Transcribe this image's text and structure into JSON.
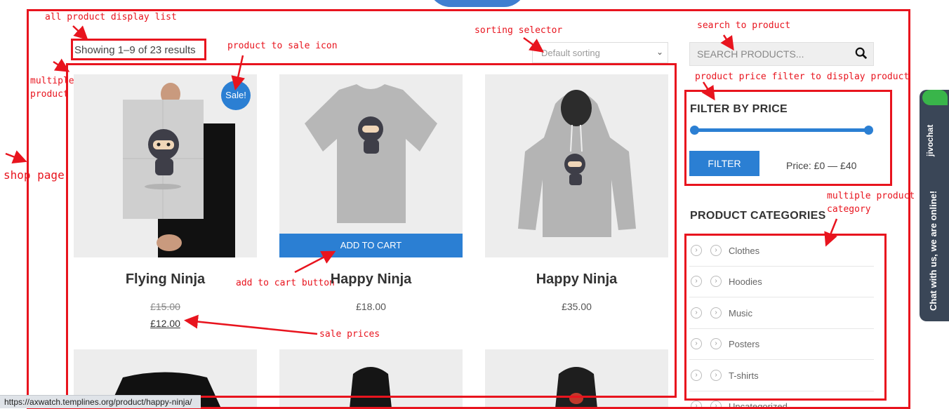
{
  "shop": {
    "results_count": "Showing 1–9 of 23 results",
    "sort_selected": "Default sorting",
    "search_placeholder": "SEARCH PRODUCTS..."
  },
  "products": [
    {
      "title": "Flying Ninja",
      "price_old": "£15.00",
      "price_new": "£12.00",
      "sale_label": "Sale!"
    },
    {
      "title": "Happy Ninja",
      "price": "£18.00",
      "cart_label": "ADD TO CART"
    },
    {
      "title": "Happy Ninja",
      "price": "£35.00"
    }
  ],
  "filter": {
    "title": "FILTER BY PRICE",
    "button_label": "FILTER",
    "price_text": "Price: £0 — £40"
  },
  "categories": {
    "title": "PRODUCT CATEGORIES",
    "items": [
      "Clothes",
      "Hoodies",
      "Music",
      "Posters",
      "T-shirts",
      "Uncategorized"
    ]
  },
  "annotations": {
    "all_product": "all product display list",
    "sale_icon": "product to sale icon",
    "sorting": "sorting selector",
    "search": "search to product",
    "price_filter": "product price filter to display product",
    "multiple_product_1": "multiple",
    "multiple_product_2": "product",
    "shop_page": "shop page",
    "multi_cat_1": "multiple product",
    "multi_cat_2": "category",
    "add_to_cart": "add to cart button",
    "sale_prices": "sale prices"
  },
  "chat": {
    "brand": "jivochat",
    "message": "Chat with us, we are online!"
  },
  "status_bar": {
    "url": "https://axwatch.templines.org/product/happy-ninja/"
  },
  "colors": {
    "annotation_red": "#e8141e",
    "accent_blue": "#2b7fd3",
    "chat_dark": "#3a4657"
  }
}
